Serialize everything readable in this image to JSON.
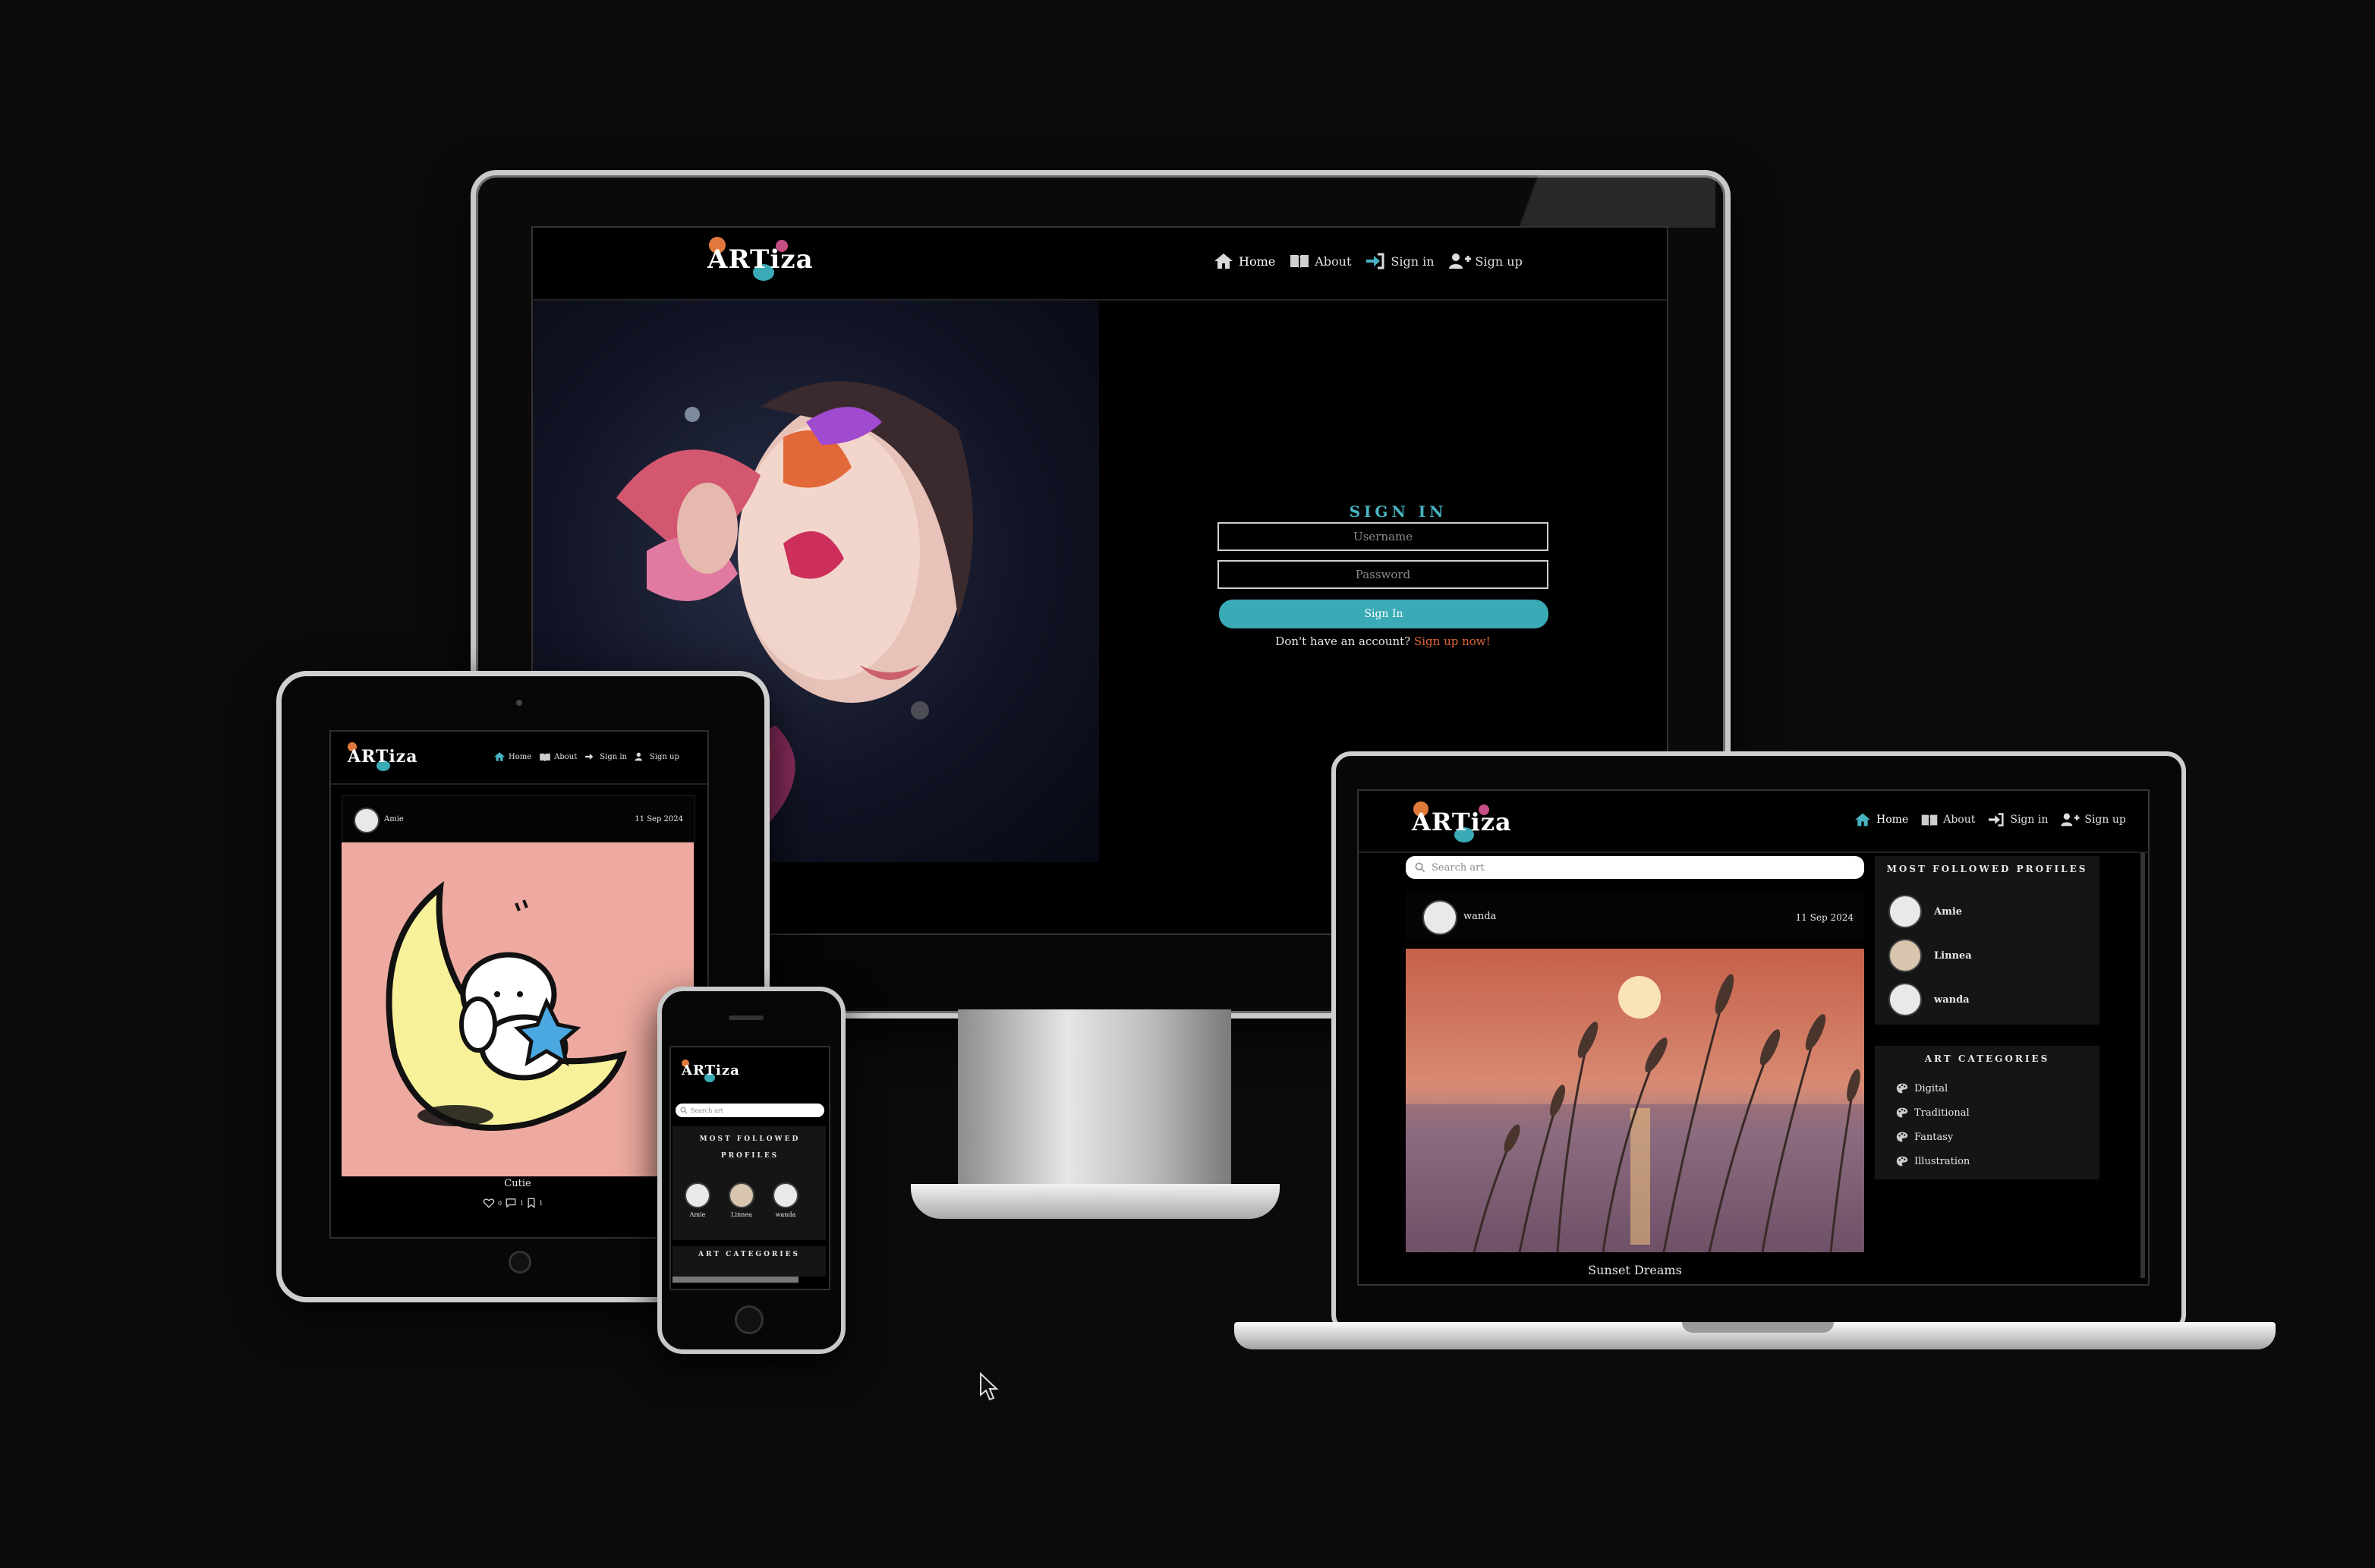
{
  "brand": {
    "name": "ARTiza"
  },
  "nav": {
    "home": "Home",
    "about": "About",
    "sign_in": "Sign in",
    "sign_up": "Sign up"
  },
  "sign_in_form": {
    "title": "SIGN IN",
    "username_placeholder": "Username",
    "password_placeholder": "Password",
    "submit_label": "Sign In",
    "prompt": "Don't have an account?",
    "signup_link": "Sign up now!"
  },
  "tablet_post": {
    "author": "Amie",
    "date": "11 Sep 2024",
    "title": "Cutie",
    "likes": "0",
    "comments": "1",
    "saves": "1"
  },
  "search": {
    "placeholder": "Search art"
  },
  "most_followed": {
    "title": "MOST FOLLOWED PROFILES",
    "profiles": [
      "Amie",
      "Linnea",
      "wanda"
    ]
  },
  "categories": {
    "title": "ART CATEGORIES",
    "items": [
      "Digital",
      "Traditional",
      "Fantasy",
      "Illustration"
    ]
  },
  "laptop_post": {
    "author": "wanda",
    "date": "11 Sep 2024",
    "title": "Sunset Dreams"
  },
  "colors": {
    "accent": "#3aaab6",
    "link": "#e0673a",
    "background": "#0b0b0b"
  }
}
